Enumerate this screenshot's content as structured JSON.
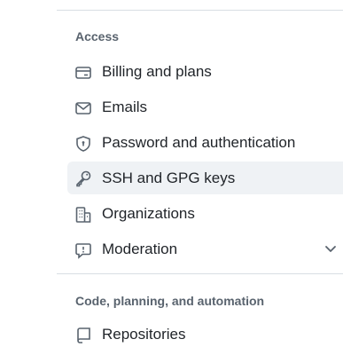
{
  "sections": {
    "access": {
      "heading": "Access",
      "items": [
        {
          "label": "Billing and plans",
          "icon": "credit-card-icon"
        },
        {
          "label": "Emails",
          "icon": "mail-icon"
        },
        {
          "label": "Password and authentication",
          "icon": "shield-lock-icon"
        },
        {
          "label": "SSH and GPG keys",
          "icon": "key-icon",
          "active": true
        },
        {
          "label": "Organizations",
          "icon": "organization-icon"
        },
        {
          "label": "Moderation",
          "icon": "report-icon",
          "expandable": true
        }
      ]
    },
    "code": {
      "heading": "Code, planning, and automation",
      "items": [
        {
          "label": "Repositories",
          "icon": "repo-icon"
        }
      ]
    }
  },
  "colors": {
    "active_bg": "#eff2f5",
    "icon": "#59636e",
    "text": "#1f2328",
    "heading": "#59636e",
    "divider": "#d8dee4"
  }
}
